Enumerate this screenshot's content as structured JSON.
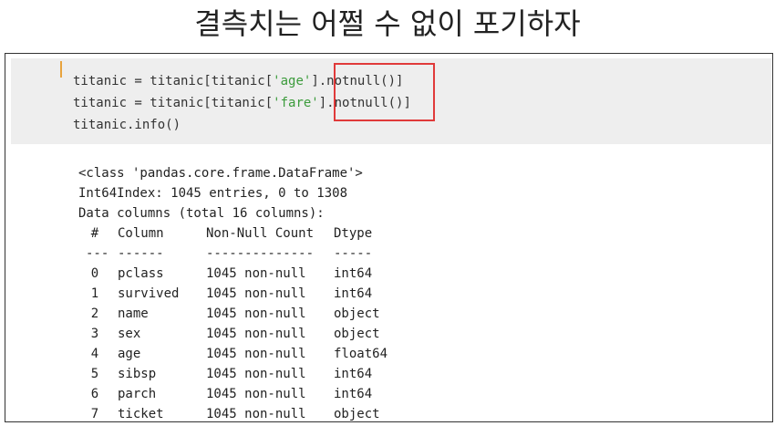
{
  "slide": {
    "title": "결측치는 어쩔 수 없이 포기하자"
  },
  "code": {
    "line1": {
      "pre": "titanic = titanic[titanic[",
      "str": "'age'",
      "post": "].notnull()]"
    },
    "line2": {
      "pre": "titanic = titanic[titanic[",
      "str": "'fare'",
      "post": "].notnull()]"
    },
    "line3": "titanic.info()"
  },
  "colors": {
    "string": "#3b9b3b",
    "highlight": "#e03a3a",
    "cell_background": "#eeeeee",
    "gutter": "#e8a33d"
  },
  "output": {
    "class_line": "<class 'pandas.core.frame.DataFrame'>",
    "index_line": "Int64Index: 1045 entries, 0 to 1308",
    "columns_line": "Data columns (total 16 columns):",
    "headers": {
      "idx": "#",
      "column": "Column",
      "count": "Non-Null Count",
      "dtype": "Dtype"
    },
    "separators": {
      "idx": "---",
      "column": "------",
      "count": "--------------",
      "dtype": "-----"
    },
    "rows": [
      {
        "idx": "0",
        "column": "pclass",
        "count": "1045 non-null",
        "dtype": "int64"
      },
      {
        "idx": "1",
        "column": "survived",
        "count": "1045 non-null",
        "dtype": "int64"
      },
      {
        "idx": "2",
        "column": "name",
        "count": "1045 non-null",
        "dtype": "object"
      },
      {
        "idx": "3",
        "column": "sex",
        "count": "1045 non-null",
        "dtype": "object"
      },
      {
        "idx": "4",
        "column": "age",
        "count": "1045 non-null",
        "dtype": "float64"
      },
      {
        "idx": "5",
        "column": "sibsp",
        "count": "1045 non-null",
        "dtype": "int64"
      },
      {
        "idx": "6",
        "column": "parch",
        "count": "1045 non-null",
        "dtype": "int64"
      },
      {
        "idx": "7",
        "column": "ticket",
        "count": "1045 non-null",
        "dtype": "object"
      }
    ]
  }
}
